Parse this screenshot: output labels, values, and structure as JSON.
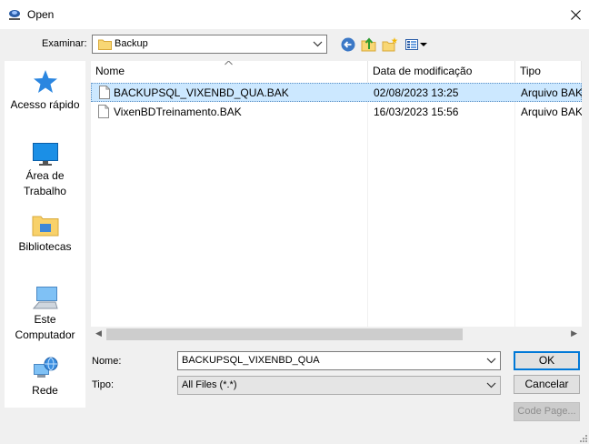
{
  "window": {
    "title": "Open"
  },
  "toolbar": {
    "lookin_label": "Examinar:",
    "lookin_value": "Backup"
  },
  "places": [
    {
      "label": "Acesso rápido",
      "icon": "star-icon"
    },
    {
      "label": "Área de Trabalho",
      "icon": "desktop-icon"
    },
    {
      "label": "Bibliotecas",
      "icon": "libraries-icon"
    },
    {
      "label": "Este Computador",
      "icon": "computer-icon"
    },
    {
      "label": "Rede",
      "icon": "network-icon"
    }
  ],
  "list": {
    "columns": [
      "Nome",
      "Data de modificação",
      "Tipo"
    ],
    "rows": [
      {
        "name": "BACKUPSQL_VIXENBD_QUA.BAK",
        "date": "02/08/2023 13:25",
        "type": "Arquivo BAK",
        "selected": true
      },
      {
        "name": "VixenBDTreinamento.BAK",
        "date": "16/03/2023 15:56",
        "type": "Arquivo BAK",
        "selected": false
      }
    ]
  },
  "form": {
    "name_label": "Nome:",
    "name_value": "BACKUPSQL_VIXENBD_QUA",
    "type_label": "Tipo:",
    "type_value": "All Files (*.*)"
  },
  "buttons": {
    "ok": "OK",
    "cancel": "Cancelar",
    "codepage": "Code Page..."
  },
  "colors": {
    "accent": "#0078d7",
    "selection": "#cce8ff"
  }
}
